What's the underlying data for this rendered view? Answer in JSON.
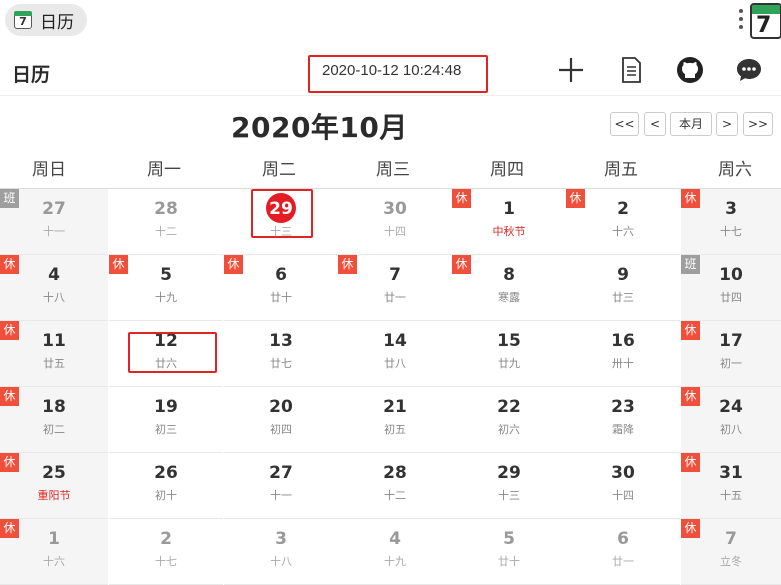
{
  "tab": {
    "icon_text": "7",
    "label": "日历"
  },
  "app_icon_text": "7",
  "header": {
    "title": "日历",
    "datetime": "2020-10-12 10:24:48"
  },
  "month_title": "2020年10月",
  "nav": {
    "prev_year": "<<",
    "prev_month": "<",
    "this_month": "本月",
    "next_month": ">",
    "next_year": ">>"
  },
  "weekdays": [
    "周日",
    "周一",
    "周二",
    "周三",
    "周四",
    "周五",
    "周六"
  ],
  "weeks": [
    [
      {
        "d": "27",
        "l": "十一",
        "other": true,
        "badge": "班"
      },
      {
        "d": "28",
        "l": "十二",
        "other": true
      },
      {
        "d": "29",
        "l": "十三",
        "other": true,
        "today": true
      },
      {
        "d": "30",
        "l": "十四",
        "other": true
      },
      {
        "d": "1",
        "l": "中秋节",
        "fest": true,
        "badge": "休"
      },
      {
        "d": "2",
        "l": "十六",
        "badge": "休"
      },
      {
        "d": "3",
        "l": "十七",
        "badge": "休"
      }
    ],
    [
      {
        "d": "4",
        "l": "十八",
        "badge": "休"
      },
      {
        "d": "5",
        "l": "十九",
        "badge": "休"
      },
      {
        "d": "6",
        "l": "廿十",
        "badge": "休"
      },
      {
        "d": "7",
        "l": "廿一",
        "badge": "休"
      },
      {
        "d": "8",
        "l": "寒露",
        "badge": "休"
      },
      {
        "d": "9",
        "l": "廿三"
      },
      {
        "d": "10",
        "l": "廿四",
        "badge": "班"
      }
    ],
    [
      {
        "d": "11",
        "l": "廿五",
        "badge": "休"
      },
      {
        "d": "12",
        "l": "廿六"
      },
      {
        "d": "13",
        "l": "廿七"
      },
      {
        "d": "14",
        "l": "廿八"
      },
      {
        "d": "15",
        "l": "廿九"
      },
      {
        "d": "16",
        "l": "卅十"
      },
      {
        "d": "17",
        "l": "初一",
        "badge": "休"
      }
    ],
    [
      {
        "d": "18",
        "l": "初二",
        "badge": "休"
      },
      {
        "d": "19",
        "l": "初三"
      },
      {
        "d": "20",
        "l": "初四"
      },
      {
        "d": "21",
        "l": "初五"
      },
      {
        "d": "22",
        "l": "初六"
      },
      {
        "d": "23",
        "l": "霜降"
      },
      {
        "d": "24",
        "l": "初八",
        "badge": "休"
      }
    ],
    [
      {
        "d": "25",
        "l": "重阳节",
        "fest": true,
        "badge": "休"
      },
      {
        "d": "26",
        "l": "初十"
      },
      {
        "d": "27",
        "l": "十一"
      },
      {
        "d": "28",
        "l": "十二"
      },
      {
        "d": "29",
        "l": "十三"
      },
      {
        "d": "30",
        "l": "十四"
      },
      {
        "d": "31",
        "l": "十五",
        "badge": "休"
      }
    ],
    [
      {
        "d": "1",
        "l": "十六",
        "other": true,
        "badge": "休"
      },
      {
        "d": "2",
        "l": "十七",
        "other": true
      },
      {
        "d": "3",
        "l": "十八",
        "other": true
      },
      {
        "d": "4",
        "l": "十九",
        "other": true
      },
      {
        "d": "5",
        "l": "廿十",
        "other": true
      },
      {
        "d": "6",
        "l": "廿一",
        "other": true
      },
      {
        "d": "7",
        "l": "立冬",
        "other": true,
        "badge": "休"
      }
    ]
  ],
  "colors": {
    "rest_badge": "#f0503b",
    "work_badge": "#9e9e9e",
    "today": "#e51c23",
    "annotation": "#e02424"
  }
}
